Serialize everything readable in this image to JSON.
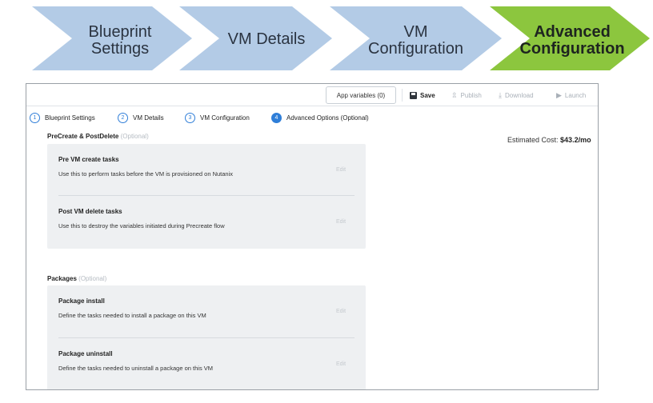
{
  "process_steps": [
    {
      "line1": "Blueprint",
      "line2": "Settings",
      "active": false
    },
    {
      "line1": "VM Details",
      "line2": "",
      "active": false
    },
    {
      "line1": "VM",
      "line2": "Configuration",
      "active": false
    },
    {
      "line1": "Advanced",
      "line2": "Configuration",
      "active": true
    }
  ],
  "colors": {
    "chevron_blue": "#b3cbe6",
    "chevron_active": "#8cc63e",
    "step_blue": "#2f7ed8"
  },
  "toolbar": {
    "app_variables_label": "App variables (0)",
    "save_label": "Save",
    "publish_label": "Publish",
    "download_label": "Download",
    "launch_label": "Launch"
  },
  "wizard_steps": [
    {
      "num": "1",
      "label": "Blueprint Settings"
    },
    {
      "num": "2",
      "label": "VM Details"
    },
    {
      "num": "3",
      "label": "VM Configuration"
    },
    {
      "num": "4",
      "label": "Advanced Options (Optional)"
    }
  ],
  "estimated_cost": {
    "label": "Estimated Cost:",
    "value": "$43.2/mo"
  },
  "precreate": {
    "title": "PreCreate & PostDelete",
    "optional": "(Optional)",
    "tasks": [
      {
        "title": "Pre VM create tasks",
        "desc": "Use this to perform tasks before the VM is provisioned on Nutanix",
        "edit": "Edit"
      },
      {
        "title": "Post VM delete tasks",
        "desc": "Use this to destroy the variables initiated during Precreate flow",
        "edit": "Edit"
      }
    ]
  },
  "packages": {
    "title": "Packages",
    "optional": "(Optional)",
    "tasks": [
      {
        "title": "Package install",
        "desc": "Define the tasks needed to install a package on this VM",
        "edit": "Edit"
      },
      {
        "title": "Package uninstall",
        "desc": "Define the tasks needed to uninstall a package on this VM",
        "edit": "Edit"
      }
    ]
  }
}
